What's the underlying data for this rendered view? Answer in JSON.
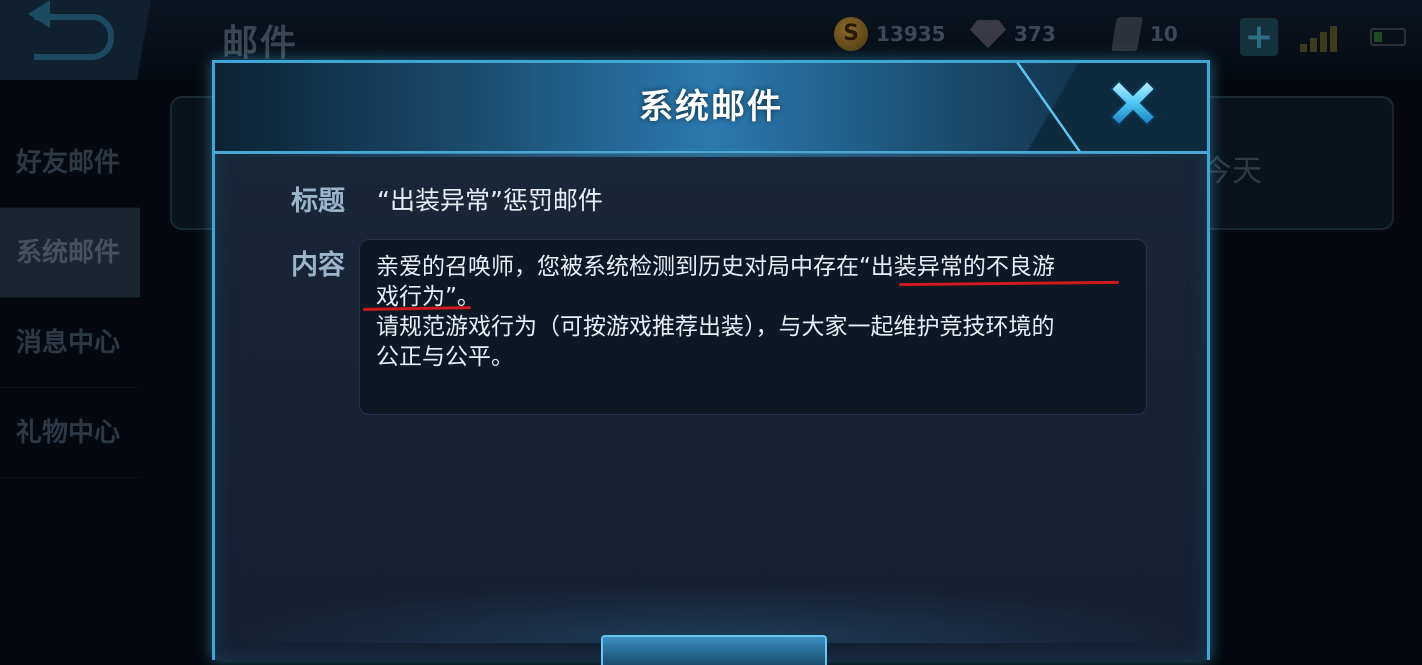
{
  "background": {
    "title": "邮件",
    "currency": {
      "gold_icon_letter": "S",
      "gold": "13935",
      "diamonds": "373",
      "cards": "10"
    },
    "sidebar": [
      {
        "label": "好友邮件"
      },
      {
        "label": "系统邮件"
      },
      {
        "label": "消息中心"
      },
      {
        "label": "礼物中心"
      }
    ],
    "active_sidebar_index": 1,
    "partial_label": "今天"
  },
  "modal": {
    "title": "系统邮件",
    "subject_label": "标题",
    "subject": "“出装异常”惩罚邮件",
    "content_label": "内容",
    "content_lines": [
      "亲爱的召唤师，您被系统检测到历史对局中存在“出装异常的不良游",
      "戏行为”。",
      "请规范游戏行为（可按游戏推荐出装），与大家一起维护竞技环境的",
      "公正与公平。"
    ]
  },
  "colors": {
    "accent_blue": "#3ea7d6",
    "annotation_red": "#d0181f"
  },
  "icons": {
    "close": "close-x-icon",
    "back": "back-arrow-icon",
    "add": "plus-icon"
  }
}
